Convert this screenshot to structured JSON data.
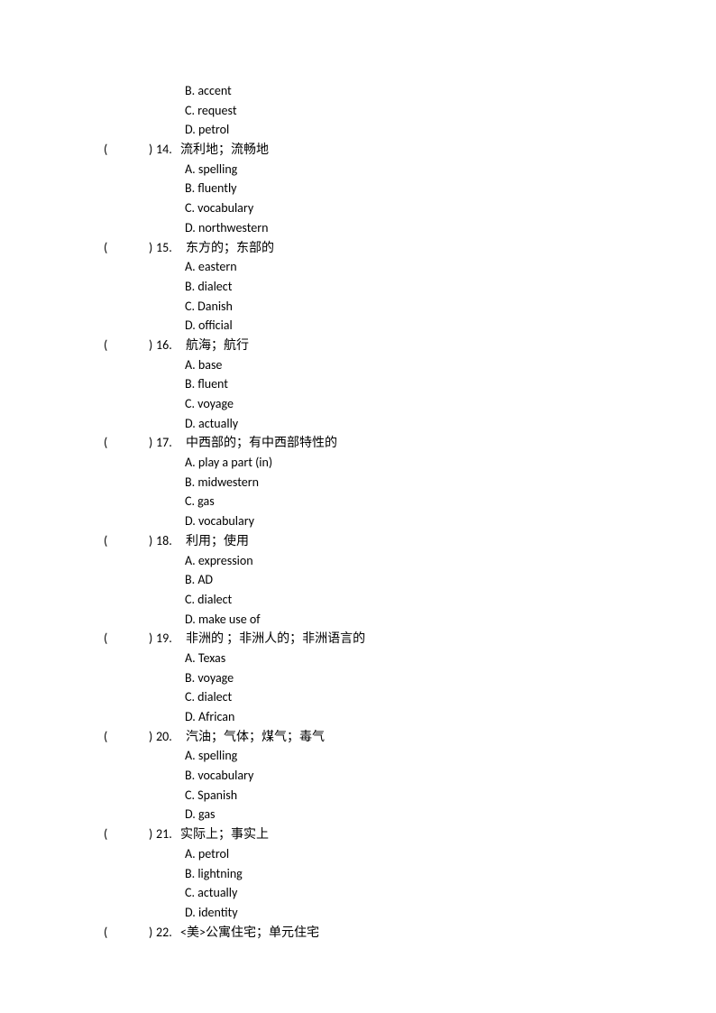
{
  "pre_options": [
    "B. accent",
    "C. request",
    "D. petrol"
  ],
  "questions": [
    {
      "num": "14.",
      "text": "流利地；流畅地",
      "spaced": false,
      "options": [
        "A. spelling",
        "B. fluently",
        "C. vocabulary",
        "D. northwestern"
      ]
    },
    {
      "num": "15.",
      "text": "东方的；东部的",
      "spaced": true,
      "options": [
        "A. eastern",
        "B. dialect",
        "C. Danish",
        "D. official"
      ]
    },
    {
      "num": "16.",
      "text": "航海；航行",
      "spaced": true,
      "options": [
        "A. base",
        "B. fluent",
        "C. voyage",
        "D. actually"
      ]
    },
    {
      "num": "17.",
      "text": "中西部的；有中西部特性的",
      "spaced": true,
      "options": [
        "A. play a part (in)",
        "B. midwestern",
        "C. gas",
        "D. vocabulary"
      ]
    },
    {
      "num": "18.",
      "text": "利用；使用",
      "spaced": true,
      "options": [
        "A. expression",
        "B. AD",
        "C. dialect",
        "D. make use of"
      ]
    },
    {
      "num": "19.",
      "text": "非洲的 ；非洲人的；非洲语言的",
      "spaced": true,
      "options": [
        "A. Texas",
        "B. voyage",
        "C. dialect",
        "D. African"
      ]
    },
    {
      "num": "20.",
      "text": "汽油；气体；煤气；毒气",
      "spaced": true,
      "options": [
        "A. spelling",
        "B. vocabulary",
        "C. Spanish",
        "D. gas"
      ]
    },
    {
      "num": "21.",
      "text": "实际上；事实上",
      "spaced": false,
      "options": [
        "A. petrol",
        "B. lightning",
        "C. actually",
        "D. identity"
      ]
    },
    {
      "num": "22.",
      "text": "<美>公寓住宅；单元住宅",
      "spaced": false,
      "options": []
    }
  ]
}
